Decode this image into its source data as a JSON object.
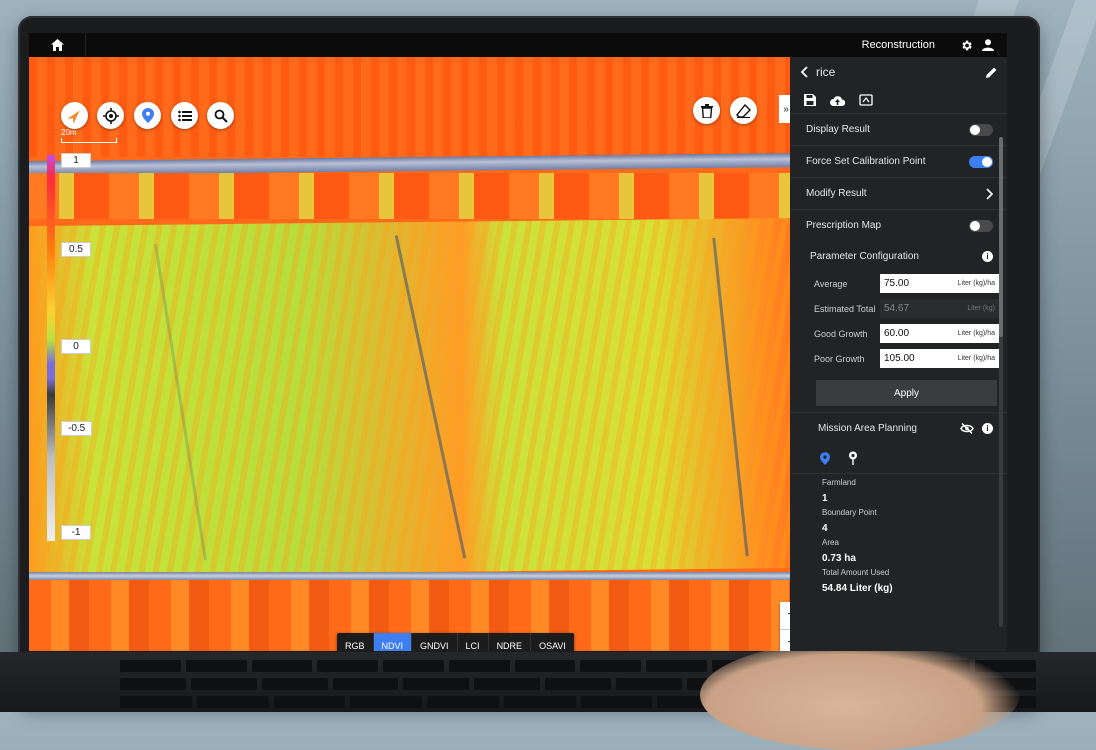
{
  "topbar": {
    "title": "Reconstruction",
    "icons": [
      "home-icon",
      "gear-icon",
      "user-icon"
    ]
  },
  "map": {
    "scale_label": "20m",
    "tools": [
      "compass-icon",
      "locate-icon",
      "pin-icon",
      "list-icon",
      "search-icon"
    ],
    "right_tools": [
      "trash-icon",
      "eraser-icon"
    ],
    "collapse_label": "»",
    "legend": {
      "labels": [
        "1",
        "0.5",
        "0",
        "-0.5",
        "-1"
      ]
    },
    "bands": {
      "tabs": [
        "RGB",
        "NDVI",
        "GNDVI",
        "LCI",
        "NDRE",
        "OSAVI"
      ],
      "selected": "NDVI"
    },
    "zoom": {
      "in": "+",
      "out": "−"
    }
  },
  "panel": {
    "name": "rice",
    "tools": [
      "save-icon",
      "upload-icon",
      "export-icon"
    ],
    "display_result": {
      "label": "Display Result",
      "on": false
    },
    "force_calibration": {
      "label": "Force Set Calibration Point",
      "on": true
    },
    "modify_result": {
      "label": "Modify Result"
    },
    "prescription_map": {
      "label": "Prescription Map",
      "on": false
    },
    "parameter_config": {
      "title": "Parameter Configuration",
      "average": {
        "label": "Average",
        "value": "75.00",
        "unit": "Liter (kg)/ha"
      },
      "estimated_total": {
        "label": "Estimated Total",
        "value": "54.67",
        "unit": "Liter (kg)"
      },
      "good_growth": {
        "label": "Good Growth",
        "value": "60.00",
        "unit": "Liter (kg)/ha"
      },
      "poor_growth": {
        "label": "Poor Growth",
        "value": "105.00",
        "unit": "Liter (kg)/ha"
      },
      "apply_label": "Apply"
    },
    "mission": {
      "title": "Mission Area Planning",
      "stats": [
        {
          "key": "Farmland",
          "value": "1"
        },
        {
          "key": "Boundary Point",
          "value": "4"
        },
        {
          "key": "Area",
          "value": "0.73 ha"
        },
        {
          "key": "Total Amount Used",
          "value": "54.84 Liter (kg)"
        }
      ]
    }
  },
  "colors": {
    "accent": "#3e7ef3",
    "panel_bg": "#222324",
    "map_orange": "#ff6a1a",
    "map_green": "#b6de3d"
  }
}
